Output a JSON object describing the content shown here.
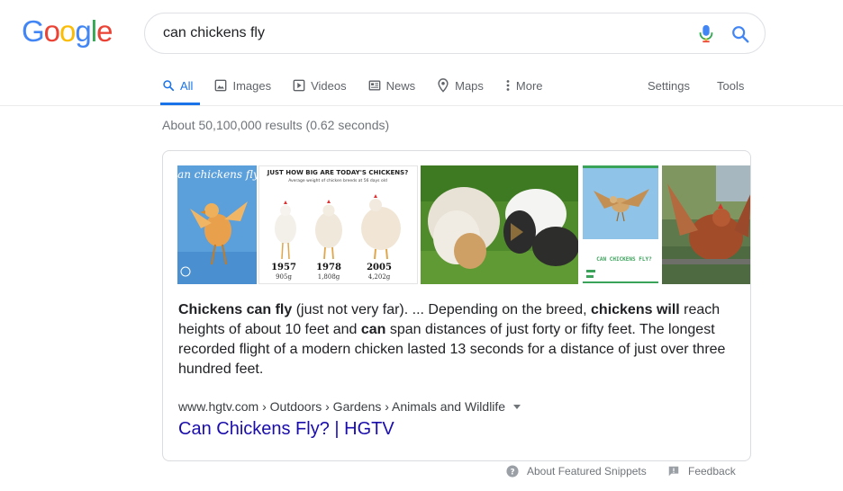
{
  "logo": {
    "letters": [
      "G",
      "o",
      "o",
      "g",
      "l",
      "e"
    ],
    "colors": [
      "#4285f4",
      "#ea4335",
      "#fbbc05",
      "#4285f4",
      "#34a853",
      "#ea4335"
    ]
  },
  "search": {
    "query": "can chickens fly"
  },
  "tabs": [
    {
      "label": "All",
      "icon": "search-icon",
      "active": true
    },
    {
      "label": "Images",
      "icon": "image-icon"
    },
    {
      "label": "Videos",
      "icon": "play-icon"
    },
    {
      "label": "News",
      "icon": "newspaper-icon"
    },
    {
      "label": "Maps",
      "icon": "map-pin-icon"
    },
    {
      "label": "More",
      "icon": "more-vert-icon"
    }
  ],
  "tools": {
    "settings": "Settings",
    "tools": "Tools"
  },
  "stats": "About 50,100,000 results (0.62 seconds)",
  "images": {
    "first": {
      "text": "Can chickens fly?"
    },
    "second": {
      "heading": "JUST HOW BIG ARE TODAY'S CHICKENS?",
      "sub": "Average weight of chicken breeds at 56 days old",
      "years": [
        "1957",
        "1978",
        "2005"
      ],
      "weights": [
        "905g",
        "1,808g",
        "4,202g"
      ]
    },
    "fourth": {
      "text": "CAN CHICKENS FLY?"
    }
  },
  "snippet": {
    "p1": "Chickens can fly",
    "p2": " (just not very far). ... Depending on the breed, ",
    "p3": "chickens will",
    "p4": " reach heights of about 10 feet and ",
    "p5": "can",
    "p6": " span distances of just forty or fifty feet. The longest recorded flight of a modern chicken lasted 13 seconds for a distance of just over three hundred feet."
  },
  "result": {
    "cite": "www.hgtv.com › Outdoors › Gardens › Animals and Wildlife",
    "title": "Can Chickens Fly? | HGTV"
  },
  "footer": {
    "about": "About Featured Snippets",
    "feedback": "Feedback"
  }
}
